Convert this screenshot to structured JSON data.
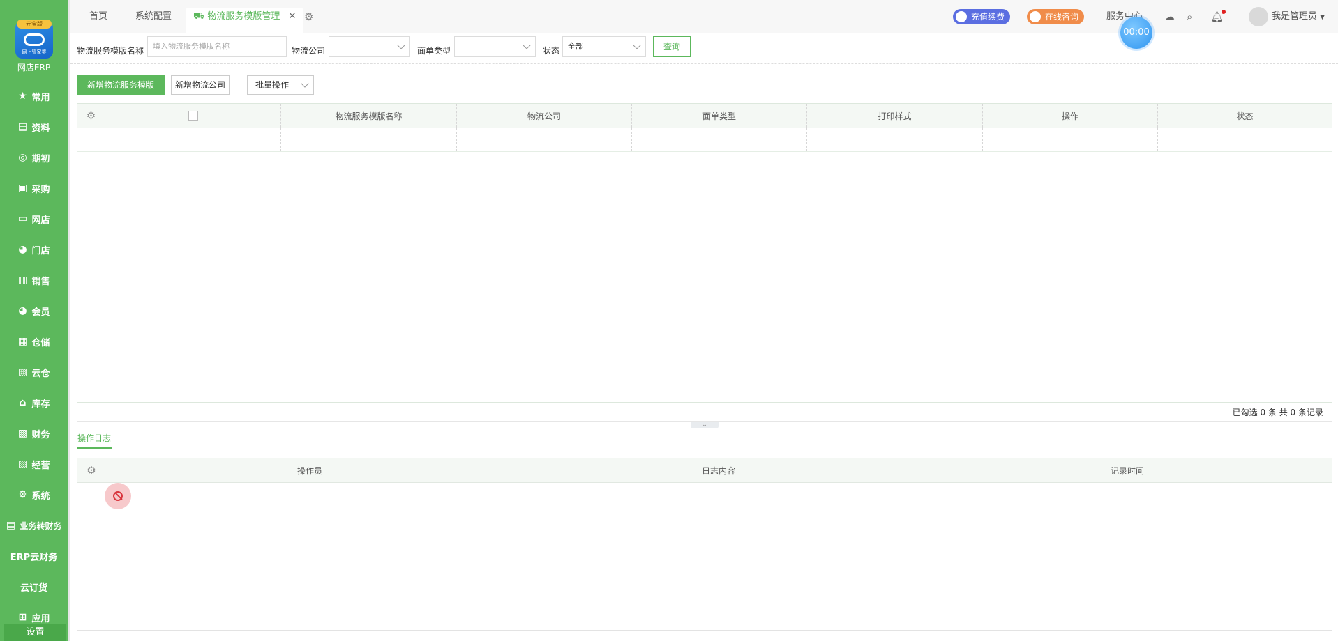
{
  "sidebar": {
    "logo_badge": "元宝版",
    "logo_subtitle": "网上管家婆",
    "logo_name": "网店ERP",
    "items": [
      {
        "label": "常用",
        "icon": "star-icon"
      },
      {
        "label": "资料",
        "icon": "document-icon"
      },
      {
        "label": "期初",
        "icon": "target-icon"
      },
      {
        "label": "采购",
        "icon": "cart-icon"
      },
      {
        "label": "网店",
        "icon": "store-icon"
      },
      {
        "label": "门店",
        "icon": "pie-icon"
      },
      {
        "label": "销售",
        "icon": "bar-chart-icon"
      },
      {
        "label": "会员",
        "icon": "pie-icon"
      },
      {
        "label": "仓储",
        "icon": "warehouse-icon"
      },
      {
        "label": "云仓",
        "icon": "cloud-warehouse-icon"
      },
      {
        "label": "库存",
        "icon": "home-icon"
      },
      {
        "label": "财务",
        "icon": "finance-icon"
      },
      {
        "label": "经营",
        "icon": "chart-icon"
      },
      {
        "label": "系统",
        "icon": "gear-icon"
      },
      {
        "label": "业务转财务",
        "icon": "transfer-icon"
      },
      {
        "label": "ERP云财务",
        "icon": ""
      },
      {
        "label": "云订货",
        "icon": ""
      },
      {
        "label": "应用",
        "icon": "plus-icon"
      }
    ],
    "bottom": "设置"
  },
  "topbar": {
    "tabs": [
      "首页",
      "系统配置",
      "物流服务模版管理"
    ],
    "recharge": "充值续费",
    "consult": "在线咨询",
    "service": "服务中心",
    "user": "我是管理员",
    "timer": "00:00"
  },
  "filters": {
    "name_label": "物流服务模版名称",
    "name_placeholder": "填入物流服务模版名称",
    "company_label": "物流公司",
    "waybill_label": "面单类型",
    "status_label": "状态",
    "status_value": "全部",
    "query": "查询"
  },
  "actions": {
    "add_template": "新增物流服务模版",
    "add_company": "新增物流公司",
    "batch": "批量操作"
  },
  "grid": {
    "columns": [
      "物流服务模版名称",
      "物流公司",
      "面单类型",
      "打印样式",
      "操作",
      "状态"
    ],
    "footer": "已勾选 0 条  共 0 条记录"
  },
  "log": {
    "tab": "操作日志",
    "columns": [
      "操作员",
      "日志内容",
      "记录时间"
    ]
  }
}
